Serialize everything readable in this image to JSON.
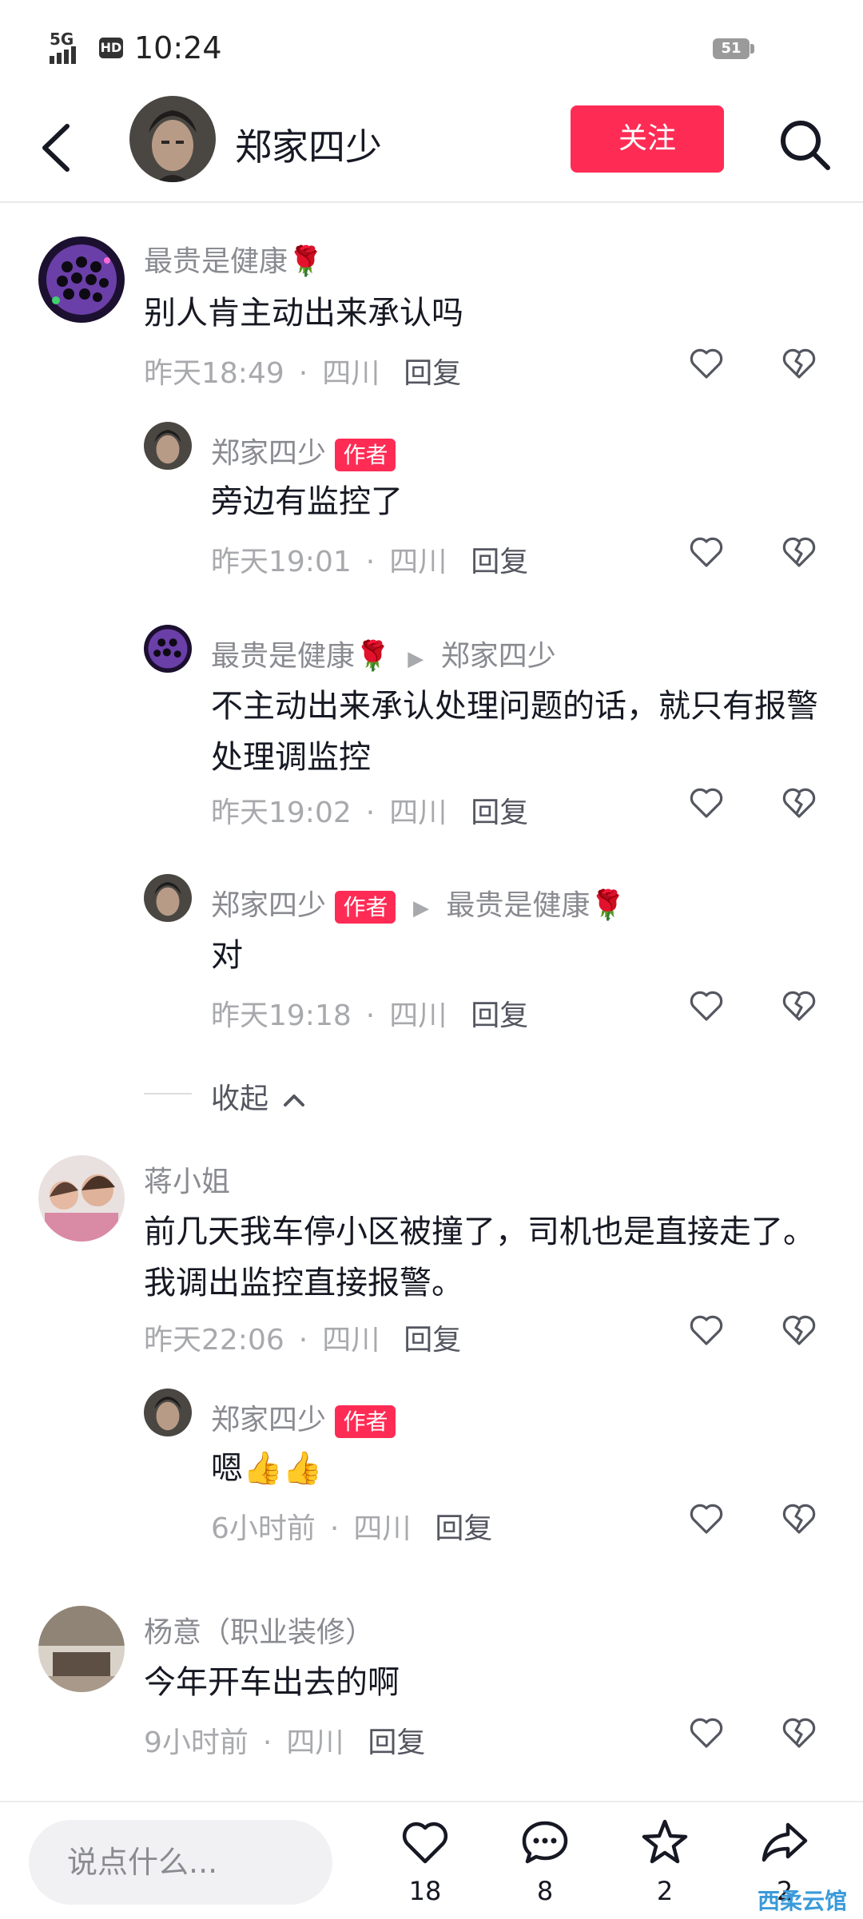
{
  "status_bar": {
    "network": "5G",
    "hd": "HD",
    "time": "10:24",
    "battery": "51"
  },
  "header": {
    "username": "郑家四少",
    "follow_label": "关注"
  },
  "comments": [
    {
      "user": "最贵是健康🌹",
      "text": "别人肯主动出来承认吗",
      "time": "昨天18:49",
      "location": "四川",
      "reply_label": "回复"
    },
    {
      "user": "郑家四少",
      "badge": "作者",
      "text": "旁边有监控了",
      "time": "昨天19:01",
      "location": "四川",
      "reply_label": "回复"
    },
    {
      "user": "最贵是健康🌹",
      "reply_to": "郑家四少",
      "text": "不主动出来承认处理问题的话，就只有报警处理调监控",
      "time": "昨天19:02",
      "location": "四川",
      "reply_label": "回复"
    },
    {
      "user": "郑家四少",
      "badge": "作者",
      "reply_to": "最贵是健康🌹",
      "text": "对",
      "time": "昨天19:18",
      "location": "四川",
      "reply_label": "回复"
    },
    {
      "user": "蒋小姐",
      "text": "前几天我车停小区被撞了，司机也是直接走了。我调出监控直接报警。",
      "time": "昨天22:06",
      "location": "四川",
      "reply_label": "回复"
    },
    {
      "user": "郑家四少",
      "badge": "作者",
      "text": "嗯👍👍",
      "time": "6小时前",
      "location": "四川",
      "reply_label": "回复"
    },
    {
      "user": "杨意（职业装修）",
      "text": "今年开车出去的啊",
      "time": "9小时前",
      "location": "四川",
      "reply_label": "回复"
    }
  ],
  "collapse_label": "收起",
  "bottom_bar": {
    "input_placeholder": "说点什么...",
    "likes": "18",
    "comments": "8",
    "favorites": "2",
    "shares": "2"
  },
  "watermark": "西柔云馆",
  "colors": {
    "accent": "#fe2c55",
    "text": "#161823",
    "muted": "#8a8b91"
  }
}
